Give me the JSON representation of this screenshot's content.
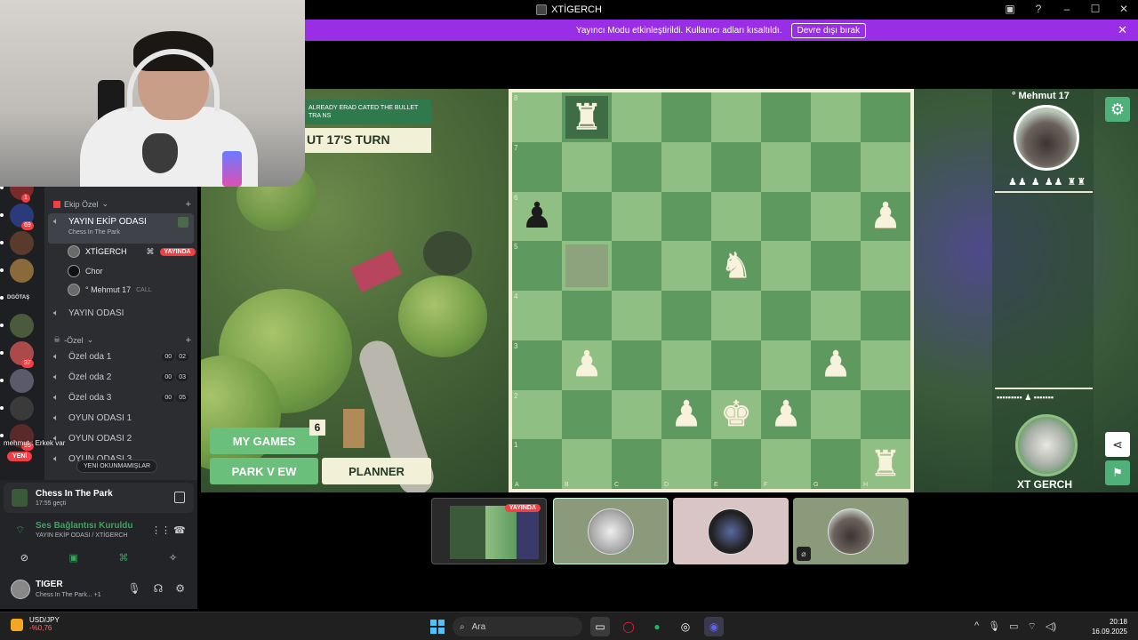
{
  "window": {
    "title": "XTİGERCH"
  },
  "banner": {
    "text": "Yayıncı Modu etkinleştirildi. Kullanıcı adları kısaltıldı.",
    "button": "Devre dışı bırak"
  },
  "servers": [
    {
      "badge": "1"
    },
    {
      "badge": "69"
    },
    {
      "badge": ""
    },
    {
      "badge": ""
    },
    {
      "label": "DGÖTAŞ"
    },
    {
      "badge": ""
    },
    {
      "badge": "37"
    },
    {
      "badge": ""
    },
    {
      "badge": ""
    },
    {
      "badge": "95"
    }
  ],
  "channels": {
    "category1": "Ekip Özel",
    "active": {
      "name": "YAYIN EKİP ODASI",
      "activity": "Chess In The Park"
    },
    "voice_users": [
      {
        "name": "XTİGERCH",
        "badge": "YAYINDA"
      },
      {
        "name": "Chor"
      },
      {
        "name": "° Mehmut 17",
        "status": "CALL"
      }
    ],
    "yayin_odasi": "YAYIN ODASI",
    "category2": "-Özel",
    "rooms": [
      {
        "name": "Özel oda 1",
        "a": "00",
        "b": "02"
      },
      {
        "name": "Özel oda 2",
        "a": "00",
        "b": "03"
      },
      {
        "name": "Özel oda 3",
        "a": "00",
        "b": "05"
      },
      {
        "name": "OYUN ODASI 1"
      },
      {
        "name": "OYUN ODASI 2"
      },
      {
        "name": "OYUN ODASI 3"
      }
    ],
    "new_unread": "YENİ OKUNMAMIŞLAR",
    "new_badge": "YENİ",
    "overlay_chat": "mehmut : Erkek var"
  },
  "activity": {
    "title": "Chess In The Park",
    "time": "17:55 geçti"
  },
  "voice": {
    "status": "Ses Bağlantısı Kuruldu",
    "channel": "YAYIN EKİP ODASI / XTİGERCH"
  },
  "user": {
    "name": "TIGER",
    "status": "Chess In The Park...",
    "extra": "+1"
  },
  "game": {
    "message_small": "ALREADY ERAD CATED THE BULLET TRA NS",
    "turn_text": "UT 17'S TURN",
    "my_games": "MY GAMES",
    "my_games_count": "6",
    "park_view": "PARK V EW",
    "planner": "PLANNER",
    "ranks": [
      "8",
      "7",
      "6",
      "5",
      "4",
      "3",
      "2",
      "1"
    ],
    "files": [
      "A",
      "B",
      "C",
      "D",
      "E",
      "F",
      "G",
      "H"
    ],
    "pieces": [
      {
        "sq": "b8",
        "piece": "rook",
        "color": "white"
      },
      {
        "sq": "a6",
        "piece": "pawn",
        "color": "black"
      },
      {
        "sq": "h6",
        "piece": "pawn",
        "color": "white"
      },
      {
        "sq": "e5",
        "piece": "knight",
        "color": "white"
      },
      {
        "sq": "b3",
        "piece": "pawn",
        "color": "white"
      },
      {
        "sq": "g3",
        "piece": "pawn",
        "color": "white"
      },
      {
        "sq": "d2",
        "piece": "pawn",
        "color": "white"
      },
      {
        "sq": "e2",
        "piece": "king",
        "color": "white"
      },
      {
        "sq": "f2",
        "piece": "pawn",
        "color": "white"
      },
      {
        "sq": "h1",
        "piece": "rook",
        "color": "white"
      }
    ],
    "highlight": [
      "b8",
      "b5"
    ],
    "player_top": "° Mehmut 17",
    "player_bottom": "XT GERCH",
    "colors": {
      "light": "#8fbf82",
      "dark": "#5e9a5f",
      "frame": "#f3f0d8",
      "button": "#6abf7a"
    }
  },
  "tiles": {
    "live": "YAYINDA"
  },
  "taskbar": {
    "stock_name": "USD/JPY",
    "stock_change": "-%0,76",
    "search": "Ara",
    "time": "20:18",
    "date": "16.09.2025"
  }
}
